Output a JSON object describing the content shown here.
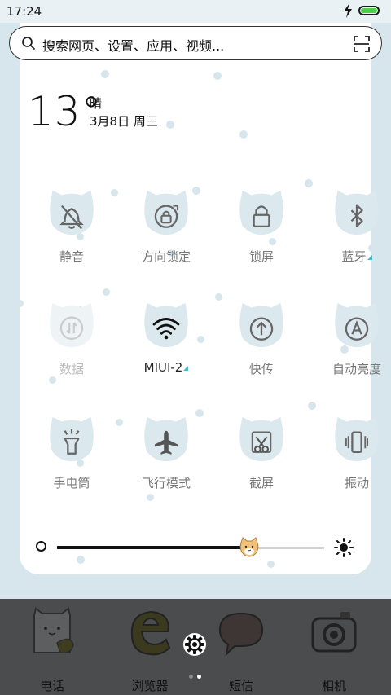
{
  "status": {
    "time": "17:24",
    "charging_icon": "lightning-icon",
    "battery_color": "#4cd24a"
  },
  "search": {
    "placeholder": "搜索网页、设置、应用、视频...",
    "icon": "search-icon",
    "scan_icon": "scan-icon"
  },
  "weather": {
    "temperature": "13°",
    "condition": "晴",
    "date": "3月8日 周三"
  },
  "toggles": [
    {
      "label": "静音",
      "icon": "bell-off-icon",
      "state": "off"
    },
    {
      "label": "方向锁定",
      "icon": "rotation-lock-icon",
      "state": "off"
    },
    {
      "label": "锁屏",
      "icon": "lock-icon",
      "state": "off"
    },
    {
      "label": "蓝牙",
      "icon": "bluetooth-icon",
      "state": "off",
      "has_more": true
    },
    {
      "label": "数据",
      "icon": "mobile-data-icon",
      "state": "disabled"
    },
    {
      "label": "MIUI-2",
      "icon": "wifi-icon",
      "state": "on",
      "has_more": true
    },
    {
      "label": "快传",
      "icon": "share-icon",
      "state": "off"
    },
    {
      "label": "自动亮度",
      "icon": "auto-brightness-icon",
      "state": "off"
    },
    {
      "label": "手电筒",
      "icon": "flashlight-icon",
      "state": "off"
    },
    {
      "label": "飞行模式",
      "icon": "airplane-icon",
      "state": "off"
    },
    {
      "label": "截屏",
      "icon": "screenshot-icon",
      "state": "off"
    },
    {
      "label": "振动",
      "icon": "vibrate-icon",
      "state": "off"
    }
  ],
  "brightness": {
    "level": 0.72,
    "min_icon": "brightness-low-icon",
    "max_icon": "brightness-high-icon",
    "thumb_icon": "cat-face-icon"
  },
  "dock": {
    "apps": [
      {
        "label": "电话",
        "icon": "phone-cat-icon"
      },
      {
        "label": "浏览器",
        "icon": "browser-e-icon"
      },
      {
        "label": "短信",
        "icon": "message-bubble-icon"
      },
      {
        "label": "相机",
        "icon": "camera-icon"
      }
    ],
    "settings_icon": "gear-icon",
    "pages": 2,
    "current_page": 2
  },
  "colors": {
    "tile": "#dbe8ee",
    "accent": "#49b7c8",
    "dock": "#4a4c4e",
    "background": "#d6e6ec"
  }
}
